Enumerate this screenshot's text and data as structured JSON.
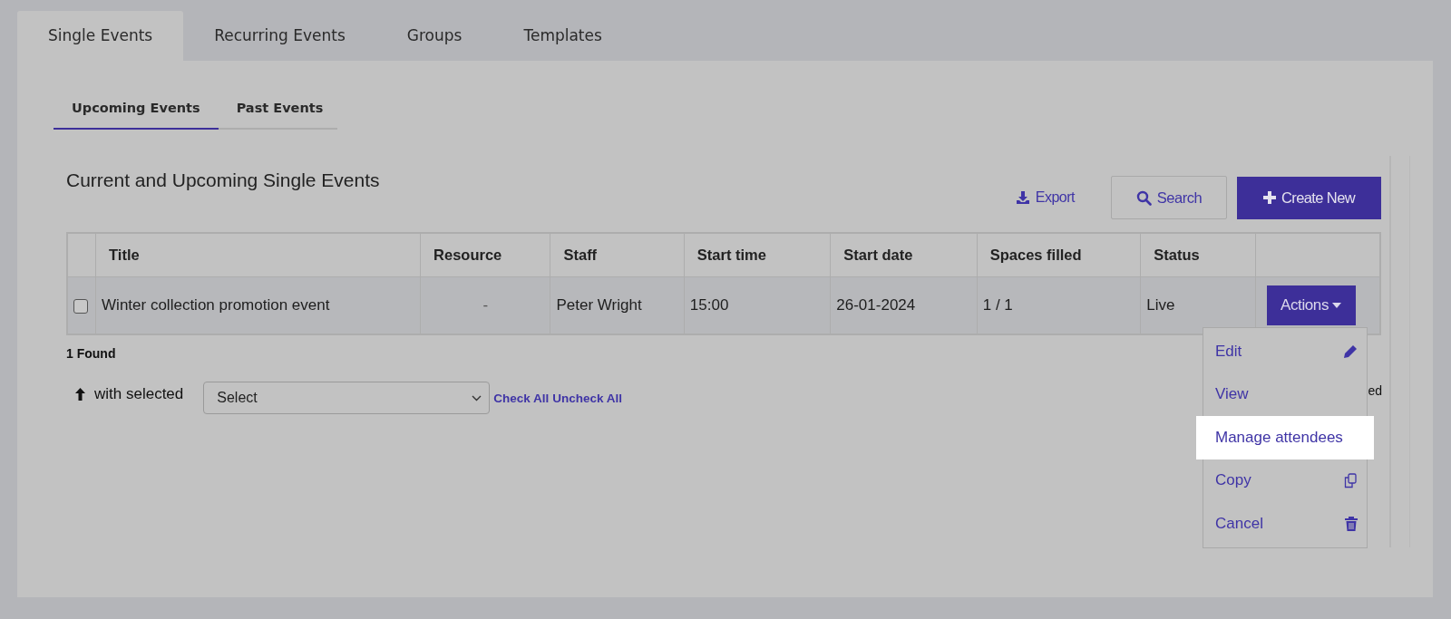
{
  "tabs": [
    {
      "label": "Single Events",
      "selected": true
    },
    {
      "label": "Recurring Events",
      "selected": false
    },
    {
      "label": "Groups",
      "selected": false
    },
    {
      "label": "Templates",
      "selected": false
    }
  ],
  "subtabs": [
    {
      "label": "Upcoming Events",
      "selected": true
    },
    {
      "label": "Past Events",
      "selected": false
    }
  ],
  "panel_title": "Current and Upcoming Single Events",
  "toolbar": {
    "export": "Export",
    "search": "Search",
    "create": "Create New"
  },
  "table": {
    "columns": [
      "Title",
      "Resource",
      "Staff",
      "Start time",
      "Start date",
      "Spaces filled",
      "Status"
    ],
    "rows": [
      {
        "checked": false,
        "cells": [
          "Winter collection promotion event",
          "-",
          "Peter Wright",
          "15:00",
          "26-01-2024",
          "1 / 1",
          "Live"
        ],
        "actions": "Actions"
      }
    ]
  },
  "found": "1 Found",
  "bulk": {
    "label": "with selected",
    "select": "Select",
    "check_all": "Check All",
    "uncheck_all": "Uncheck All",
    "partial_text": "ed"
  },
  "menu": [
    {
      "label": "Edit",
      "highlighted": false
    },
    {
      "label": "View",
      "highlighted": false
    },
    {
      "label": "Manage attendees",
      "highlighted": true
    },
    {
      "label": "Copy",
      "highlighted": false
    },
    {
      "label": "Cancel",
      "highlighted": false
    }
  ]
}
